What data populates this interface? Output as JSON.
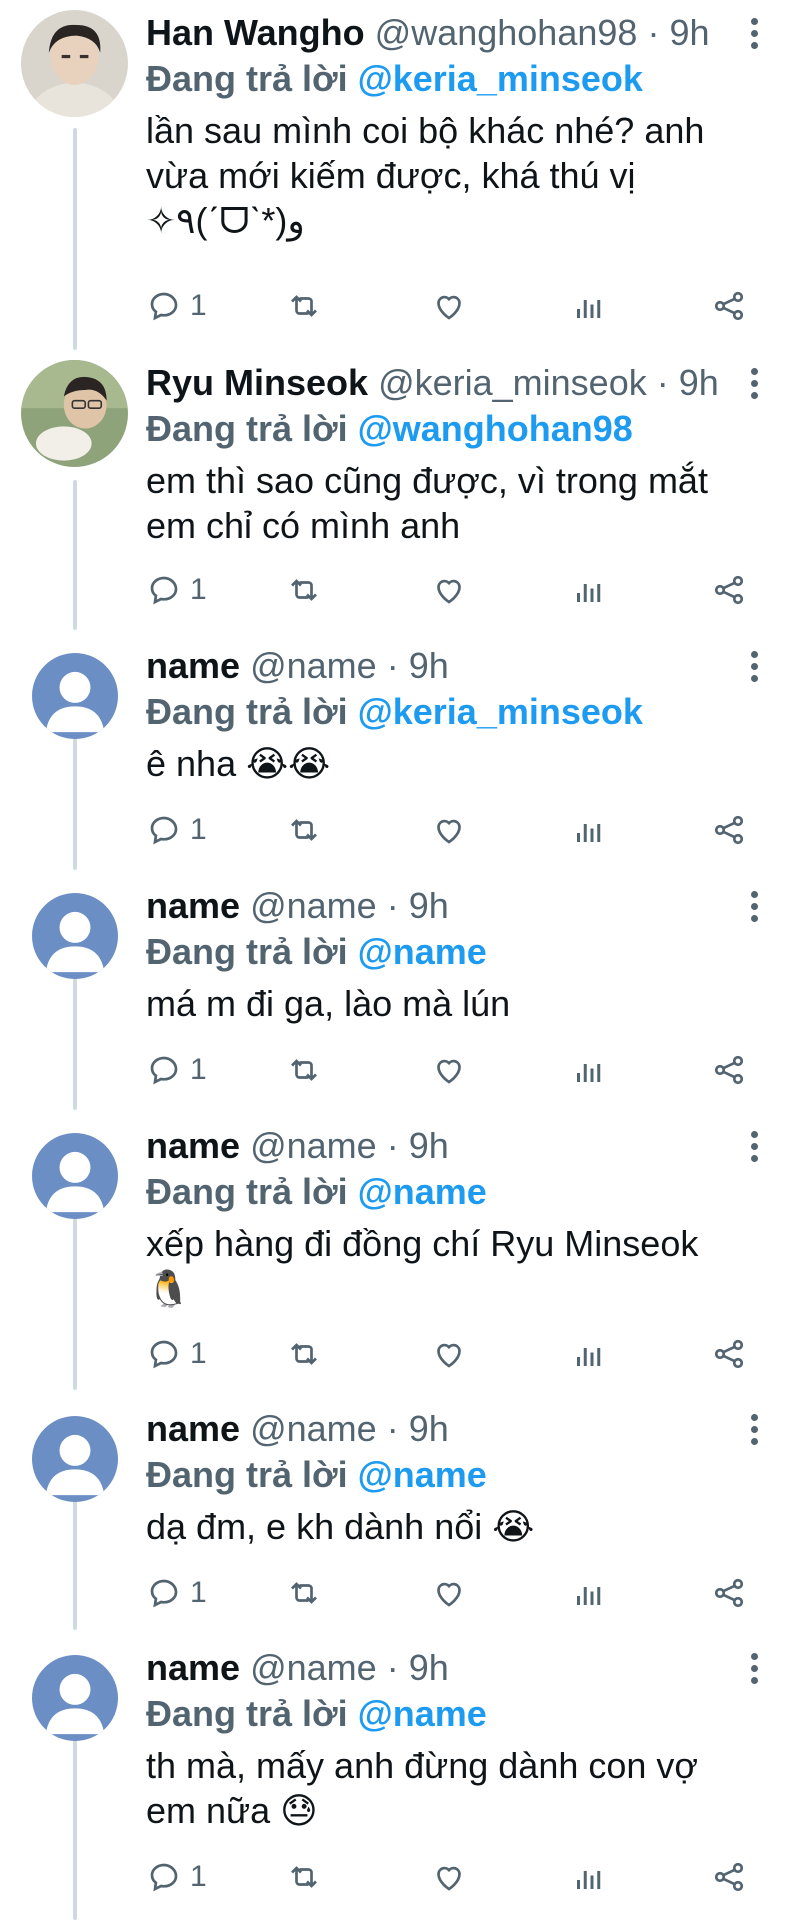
{
  "tweets": [
    {
      "name": "Han Wangho",
      "handle": "@wanghohan98",
      "time": "9h",
      "reply_prefix": "Đang trả lời",
      "reply_to": "@keria_minseok",
      "text": "lần sau mình coi bộ khác nhé? anh\nvừa mới kiếm được, khá thú vị\n✧٩(ˊᗜˋ*)و",
      "reply_count": "1",
      "avatar": "photo-male-1"
    },
    {
      "name": "Ryu Minseok",
      "handle": "@keria_minseok",
      "time": "9h",
      "reply_prefix": "Đang trả lời",
      "reply_to": "@wanghohan98",
      "text": "em thì sao cũng được, vì trong mắt\nem chỉ có mình anh",
      "reply_count": "1",
      "avatar": "photo-male-2"
    },
    {
      "name": "name",
      "handle": "@name",
      "time": "9h",
      "reply_prefix": "Đang trả lời",
      "reply_to": "@keria_minseok",
      "text": "ê nha 😭😭",
      "reply_count": "1",
      "avatar": "default-avatar"
    },
    {
      "name": "name",
      "handle": "@name",
      "time": "9h",
      "reply_prefix": "Đang trả lời",
      "reply_to": "@name",
      "text": "má m đi ga, lào mà lún",
      "reply_count": "1",
      "avatar": "default-avatar"
    },
    {
      "name": "name",
      "handle": "@name",
      "time": "9h",
      "reply_prefix": "Đang trả lời",
      "reply_to": "@name",
      "text": "xếp hàng đi đồng chí Ryu Minseok\n🐧",
      "reply_count": "1",
      "avatar": "default-avatar"
    },
    {
      "name": "name",
      "handle": "@name",
      "time": "9h",
      "reply_prefix": "Đang trả lời",
      "reply_to": "@name",
      "text": "dạ đm, e kh dành nổi 😭",
      "reply_count": "1",
      "avatar": "default-avatar"
    },
    {
      "name": "name",
      "handle": "@name",
      "time": "9h",
      "reply_prefix": "Đang trả lời",
      "reply_to": "@name",
      "text": "th mà, mấy anh đừng dành con vợ\nem nữa 😓",
      "reply_count": "1",
      "avatar": "default-avatar"
    }
  ],
  "colors": {
    "accent": "#1d9bf0",
    "muted": "#536471",
    "text": "#0f1419",
    "avatar_default": "#6b8ec4"
  }
}
